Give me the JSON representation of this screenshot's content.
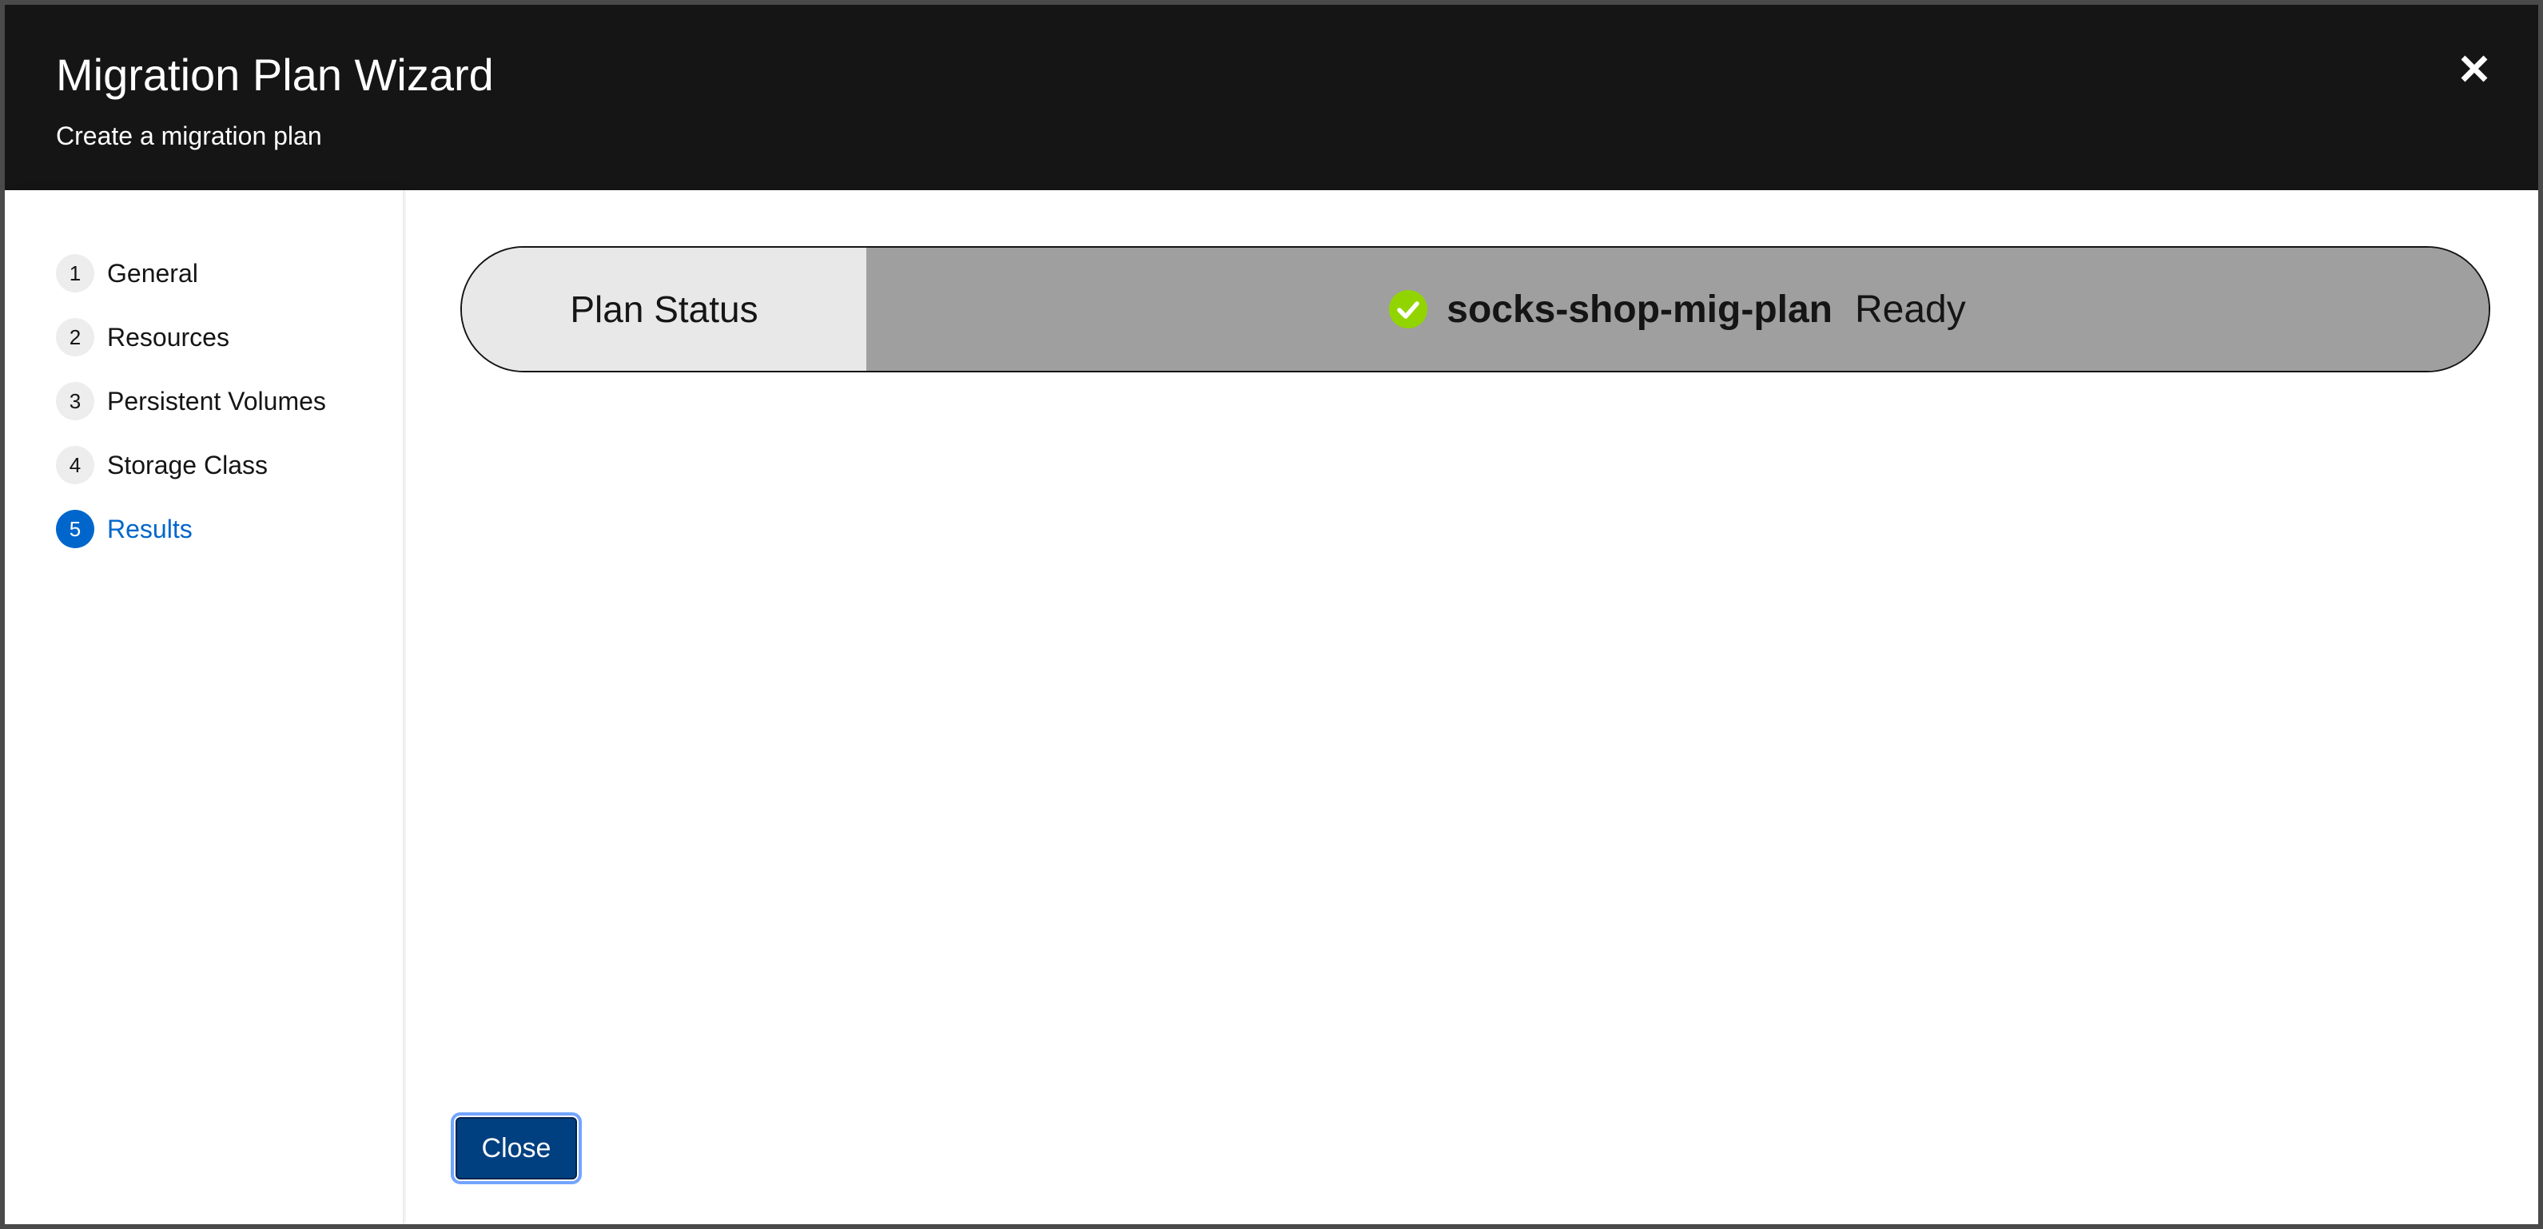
{
  "header": {
    "title": "Migration Plan Wizard",
    "subtitle": "Create a migration plan",
    "close_icon": "close-icon"
  },
  "nav": {
    "steps": [
      {
        "number": "1",
        "label": "General"
      },
      {
        "number": "2",
        "label": "Resources"
      },
      {
        "number": "3",
        "label": "Persistent Volumes"
      },
      {
        "number": "4",
        "label": "Storage Class"
      },
      {
        "number": "5",
        "label": "Results",
        "current": true
      }
    ]
  },
  "status": {
    "label": "Plan Status",
    "plan_name": "socks-shop-mig-plan",
    "state": "Ready",
    "icon": "check-circle-icon",
    "icon_color": "#92d400"
  },
  "footer": {
    "close_label": "Close"
  },
  "colors": {
    "header_bg": "#151515",
    "accent": "#0066cc",
    "primary_button": "#004080",
    "pill_body": "#9f9f9f",
    "pill_label": "#e8e8e8"
  }
}
